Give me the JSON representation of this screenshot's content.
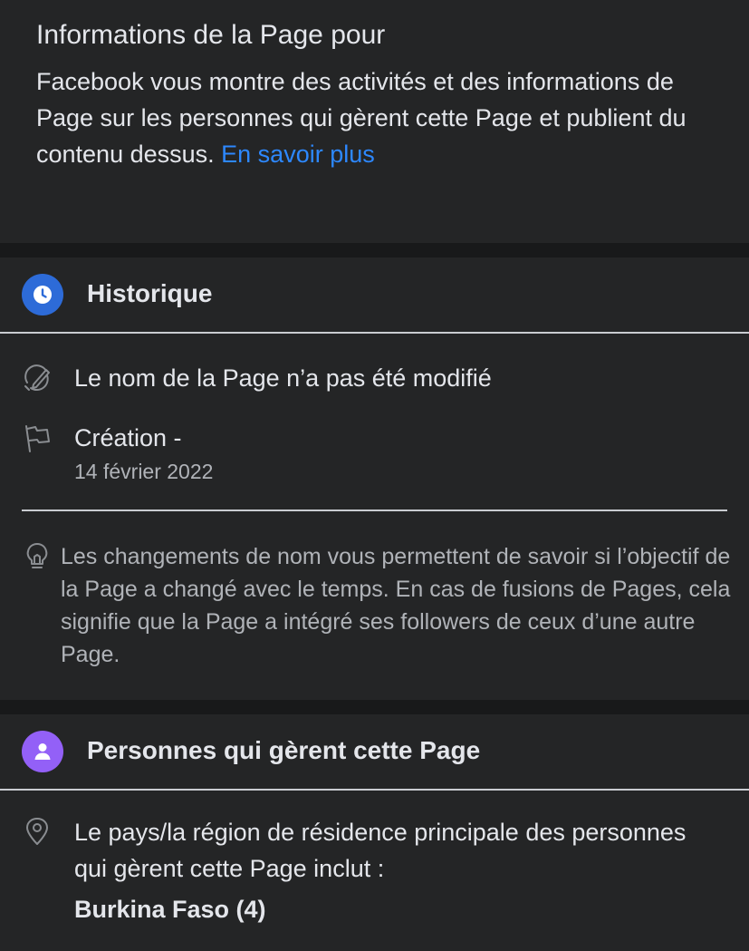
{
  "intro": {
    "title": "Informations de la Page pour",
    "description": "Facebook vous montre des activités et des informations de Page sur les personnes qui gèrent cette Page et publient du contenu dessus.",
    "learn_more": "En savoir plus"
  },
  "history": {
    "title": "Historique",
    "icon": "clock-icon",
    "accent": "#2d6bd8",
    "name_change": "Le nom de la Page n’a pas été modifié",
    "creation_label": "Création -",
    "creation_date": "14 février 2022",
    "tip": "Les changements de nom vous permettent de savoir si l’objectif de la Page a changé avec le temps. En cas de fusions de Pages, cela signifie que la Page a intégré ses followers de ceux d’une autre Page."
  },
  "managers": {
    "title": "Personnes qui gèrent cette Page",
    "icon": "person-icon",
    "accent": "#9360f7",
    "location_text": "Le pays/la région de résidence principale des personnes qui gèrent cette Page inclut :",
    "country": "Burkina Faso (4)"
  },
  "colors": {
    "background": "#18191a",
    "card": "#242526",
    "text_primary": "#e4e6eb",
    "text_secondary": "#b0b3b8",
    "link": "#2d88ff"
  }
}
